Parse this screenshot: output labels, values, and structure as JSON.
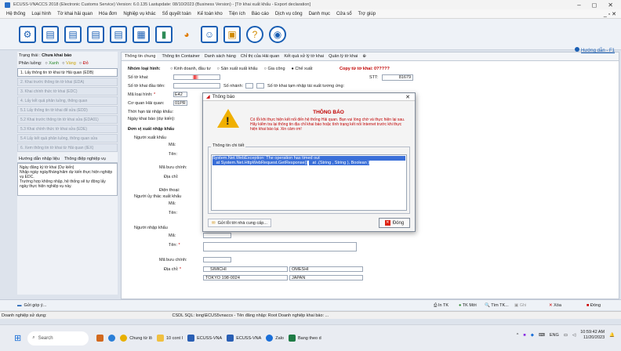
{
  "window": {
    "title": "ECUSS-VNACCS 2018 (Electronic Customs Service) Version: 6.0.135 Lastupdate: 08/10/2023 (Business Version) - [Tờ khai xuất khẩu - Export declaration]",
    "min": "–",
    "max": "◻",
    "close": "✕"
  },
  "menu": {
    "items": [
      "Hệ thống",
      "Loại hình",
      "Tờ khai hải quan",
      "Hóa đơn",
      "Nghiệp vụ khác",
      "Sổ quyết toán",
      "Kế toán kho",
      "Tiện ích",
      "Báo cáo",
      "Dịch vụ công",
      "Danh mục",
      "Cửa sổ",
      "Trợ giúp"
    ],
    "right_controls": "_ ▫ ✕"
  },
  "toolbar": {
    "icons": [
      "gear-icon",
      "document-icon",
      "document-2-icon",
      "document-3-icon",
      "document-4-icon",
      "report-icon",
      "bar-chart-icon",
      "pie-chart-icon",
      "users-icon",
      "calculator-icon",
      "help-icon",
      "chrome-icon"
    ]
  },
  "left": {
    "status_label": "Trạng thái :",
    "status_value": "Chưa khai báo",
    "stream_label": "Phân luồng:",
    "streams": [
      "Xanh",
      "Vàng",
      "Đỏ"
    ],
    "steps": [
      "1. Lấy thông tin tờ khai từ Hải quan (EDB)",
      "2. Khai trước thông tin tờ khai (EDA)",
      "3. Khai chính thức tờ khai (EDC)",
      "4. Lấy kết quả phân luồng, thông quan",
      "5.1 Lấy thông tin tờ khai để sửa (EDD)",
      "5.2 Khai trước thông tin tờ khai sửa (EDA01)",
      "5.3 Khai chính thức tờ khai sửa (EDE)",
      "5.4 Lấy kết quả phân luồng, thông quan sửa",
      "6. Xem thông tin tờ khai từ Hải quan (IEX)"
    ],
    "help_tabs": [
      "Hướng dẫn nhập liệu",
      "Thông điệp nghiệp vụ"
    ],
    "note": "Ngày đăng ký tờ khai (Dự kiến)\nNhập ngày ngày/tháng/năm dự kiến thực hiện nghiệp vụ EDC.\nTrường hợp không nhập, hệ thống sẽ tự động lấy ngày thực hiện nghiệp vụ này."
  },
  "main": {
    "tabs": [
      "Thông tin chung",
      "Thông tin Container",
      "Danh sách hàng",
      "Chỉ thị của Hải quan",
      "Kết quả xử lý tờ khai",
      "Quản lý tờ khai"
    ],
    "help_link": "Hướng dẫn - F1",
    "group_label": "Nhóm loại hình:",
    "group_opts": [
      "Kinh doanh, đầu tư",
      "Sản xuất xuất khẩu",
      "Gia công",
      "Chế xuất"
    ],
    "copy_label": "Copy từ tờ khai:",
    "copy_value": "0?????",
    "stt_label": "STT:",
    "stt_value": "81679",
    "fields": {
      "so_to_khai": "Số tờ khai:",
      "so_to_khai_dau": "Số tờ khai đầu tiên:",
      "so_nhanh": "Số nhánh:",
      "so_tam_nhap": "Số tờ khai tạm nhập tái xuất tương ứng:",
      "ma_loai_hinh": "Mã loại hình:",
      "ma_loai_hinh_val": "E42",
      "co_quan": "Cơ quan Hải quan:",
      "co_quan_val": "01PR",
      "thoi_han": "Thời hạn tái nhập khẩu:",
      "ngay_khai": "Ngày khai báo (dự kiến):",
      "don_vi": "Đơn vị xuất nhập khẩu",
      "nguoi_xk": "Người xuất khẩu",
      "ma": "Mã:",
      "ten": "Tên:",
      "ma_buu_chinh": "Mã bưu chính:",
      "dia_chi": "Địa chỉ:",
      "dien_thoai": "Điện thoại:",
      "nguoi_uy_thac": "Người ủy thác xuất khẩu",
      "nguoi_nk": "Người nhập khẩu",
      "ten_req": "Tên:",
      "ma_buu_chinh2": "Mã bưu chính:",
      "dia_chi2": "Địa chỉ:",
      "addr1": "SIMICHI",
      "addr2": "OMESHI",
      "addr3": "TOKYO 198-0024",
      "addr4": "JAPAN"
    }
  },
  "dialog": {
    "title": "Thông báo",
    "close": "✕",
    "heading": "THÔNG BÁO",
    "message": "Có lỗi khi thực hiện kết nối đến hệ thống Hải quan. Bạn vui lòng chờ và thực hiện lại sau.\nHãy kiểm tra lại thông tin địa chỉ khai báo hoặc tình trạng kết nối Internet trước khi thực hiện khai báo lại. Xin cảm ơn!",
    "group": "Thông tin chi tiết",
    "detail": [
      "System.Net.WebException: The operation has timed out",
      "   at System.Net.HttpWebRequest.GetResponse()",
      "   at .(String , String ), Boolean )"
    ],
    "send": "Gửi lỗi tới nhà cung cấp...",
    "ok": "Đóng"
  },
  "bottom": {
    "feedback": "Gửi góp ý...",
    "buttons": [
      "In TK",
      "TK Mới",
      "Tìm TK...",
      "Ghi",
      "Xóa",
      "Đóng"
    ]
  },
  "status": {
    "left": "Doanh nghiệp sử dụng: ",
    "right": "CSDL SQL: long\\ECUS5vnaccs - Tên đăng nhập: Root  Doanh nghiệp khai báo: ..."
  },
  "taskbar": {
    "search": "Search",
    "apps": [
      "Chung từ lô",
      "10 cont I",
      "ECUSS-VNA",
      "ECUSS-VNA",
      "Zalo",
      "Bang theo d"
    ],
    "lang": "ENG",
    "time": "10:59:42 AM",
    "date": "11/20/2023"
  }
}
